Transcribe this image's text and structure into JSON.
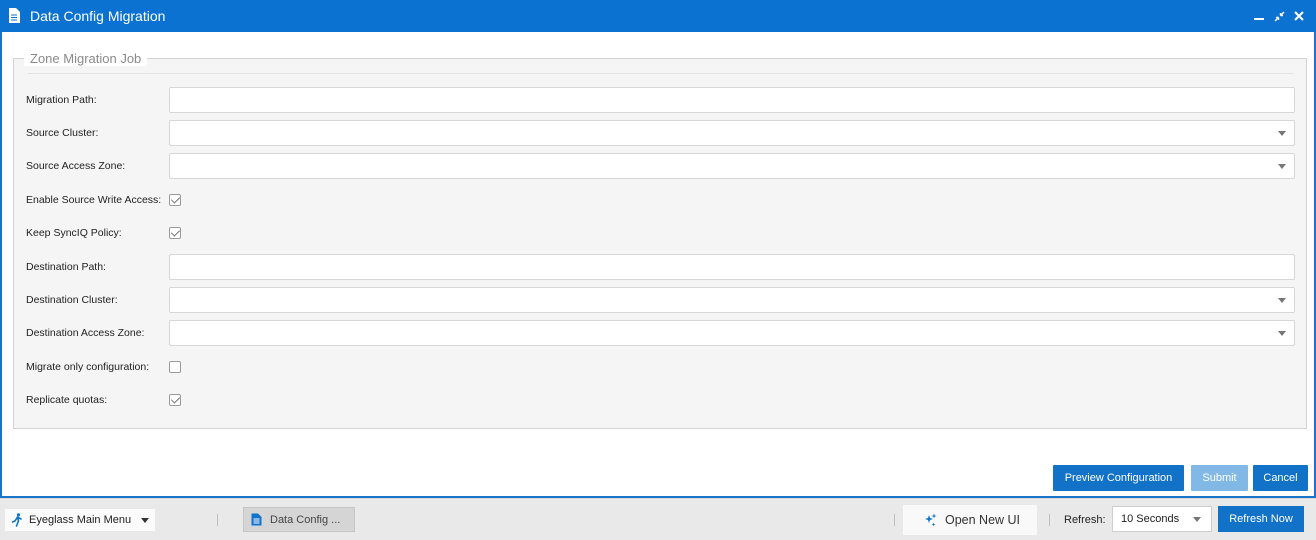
{
  "window": {
    "title": "Data Config Migration",
    "controls": {
      "minimize": "minimize-icon",
      "restore": "restore-icon",
      "close": "close-icon"
    }
  },
  "form": {
    "legend": "Zone Migration Job",
    "fields": [
      {
        "label": "Migration Path:",
        "type": "text",
        "value": ""
      },
      {
        "label": "Source Cluster:",
        "type": "select",
        "value": ""
      },
      {
        "label": "Source Access Zone:",
        "type": "select",
        "value": ""
      },
      {
        "label": "Enable Source Write Access:",
        "type": "checkbox",
        "checked": true
      },
      {
        "label": "Keep SyncIQ Policy:",
        "type": "checkbox",
        "checked": true
      },
      {
        "label": "Destination Path:",
        "type": "text",
        "value": ""
      },
      {
        "label": "Destination Cluster:",
        "type": "select",
        "value": ""
      },
      {
        "label": "Destination Access Zone:",
        "type": "select",
        "value": ""
      },
      {
        "label": "Migrate only configuration:",
        "type": "checkbox",
        "checked": false
      },
      {
        "label": "Replicate quotas:",
        "type": "checkbox",
        "checked": true
      }
    ]
  },
  "actions": {
    "preview_label": "Preview Configuration",
    "submit_label": "Submit",
    "cancel_label": "Cancel"
  },
  "taskbar": {
    "main_menu_label": "Eyeglass Main Menu",
    "task_label": "Data Config ...",
    "new_ui_label": "Open New UI",
    "refresh_label": "Refresh:",
    "refresh_value": "10 Seconds",
    "refresh_now_label": "Refresh Now"
  },
  "colors": {
    "titlebar": "#0b72d2",
    "primary_button": "#1172c8",
    "disabled_button": "#82b8e6"
  }
}
